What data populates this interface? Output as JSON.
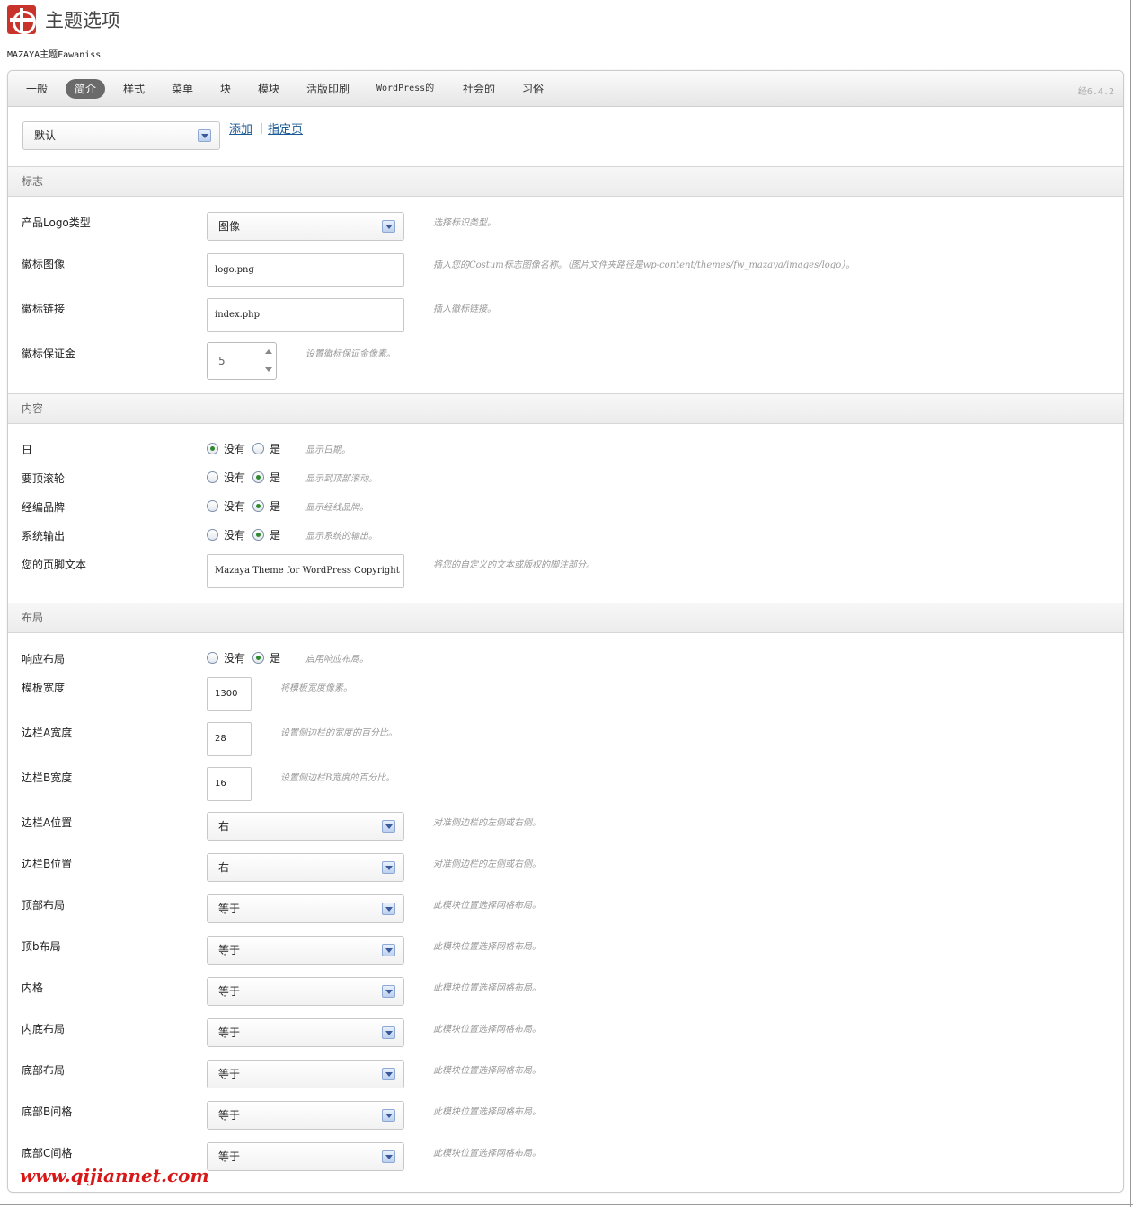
{
  "header": {
    "title": "主题选项",
    "subtitle": "MAZAYA主题Fawaniss"
  },
  "tabs": [
    "一般",
    "简介",
    "样式",
    "菜单",
    "块",
    "模块",
    "活版印刷",
    "WordPress的",
    "社会的",
    "习俗"
  ],
  "active_tab": "简介",
  "version": "经6.4.2",
  "profile": {
    "selected": "默认",
    "add_link": "添加",
    "assign_link": "指定页"
  },
  "sections": {
    "logo": {
      "title": "标志",
      "logo_type": {
        "label": "产品Logo类型",
        "value": "图像",
        "hint": "选择标识类型。"
      },
      "logo_image": {
        "label": "徽标图像",
        "value": "logo.png",
        "hint": "插入您的Costum标志图像名称。（图片文件夹路径是wp-content/themes/fw_mazaya/images/logo）。"
      },
      "logo_link": {
        "label": "徽标链接",
        "value": "index.php",
        "hint": "插入徽标链接。"
      },
      "logo_margin": {
        "label": "徽标保证金",
        "value": "5",
        "hint": "设置徽标保证金像素。"
      }
    },
    "content": {
      "title": "内容",
      "date": {
        "label": "日",
        "no": "没有",
        "yes": "是",
        "selected": "no",
        "hint": "显示日期。"
      },
      "scroll_top": {
        "label": "要顶滚轮",
        "no": "没有",
        "yes": "是",
        "selected": "yes",
        "hint": "显示到顶部滚动。"
      },
      "brand": {
        "label": "经编品牌",
        "no": "没有",
        "yes": "是",
        "selected": "yes",
        "hint": "显示经线品牌。"
      },
      "system_output": {
        "label": "系统输出",
        "no": "没有",
        "yes": "是",
        "selected": "yes",
        "hint": "显示系统的输出。"
      },
      "footer_text": {
        "label": "您的页脚文本",
        "value": "Mazaya Theme for WordPress Copyright",
        "hint": "将您的自定义的文本或版权的脚注部分。"
      }
    },
    "layout": {
      "title": "布局",
      "responsive": {
        "label": "响应布局",
        "no": "没有",
        "yes": "是",
        "selected": "yes",
        "hint": "启用响应布局。"
      },
      "template_width": {
        "label": "模板宽度",
        "value": "1300",
        "hint": "将模板宽度像素。"
      },
      "sidebar_a_width": {
        "label": "边栏A宽度",
        "value": "28",
        "hint": "设置侧边栏的宽度的百分比。"
      },
      "sidebar_b_width": {
        "label": "边栏B宽度",
        "value": "16",
        "hint": "设置侧边栏B宽度的百分比。"
      },
      "sidebar_a_pos": {
        "label": "边栏A位置",
        "value": "右",
        "hint": "对准侧边栏的左侧或右侧。"
      },
      "sidebar_b_pos": {
        "label": "边栏B位置",
        "value": "右",
        "hint": "对准侧边栏的左侧或右侧。"
      },
      "grids": [
        {
          "label": "顶部布局",
          "value": "等于",
          "hint": "此模块位置选择网格布局。"
        },
        {
          "label": "顶b布局",
          "value": "等于",
          "hint": "此模块位置选择网格布局。"
        },
        {
          "label": "内格",
          "value": "等于",
          "hint": "此模块位置选择网格布局。"
        },
        {
          "label": "内底布局",
          "value": "等于",
          "hint": "此模块位置选择网格布局。"
        },
        {
          "label": "底部布局",
          "value": "等于",
          "hint": "此模块位置选择网格布局。"
        },
        {
          "label": "底部B间格",
          "value": "等于",
          "hint": "此模块位置选择网格布局。"
        },
        {
          "label": "底部C间格",
          "value": "等于",
          "hint": "此模块位置选择网格布局。"
        }
      ]
    }
  },
  "watermark": "www.qijiannet.com"
}
